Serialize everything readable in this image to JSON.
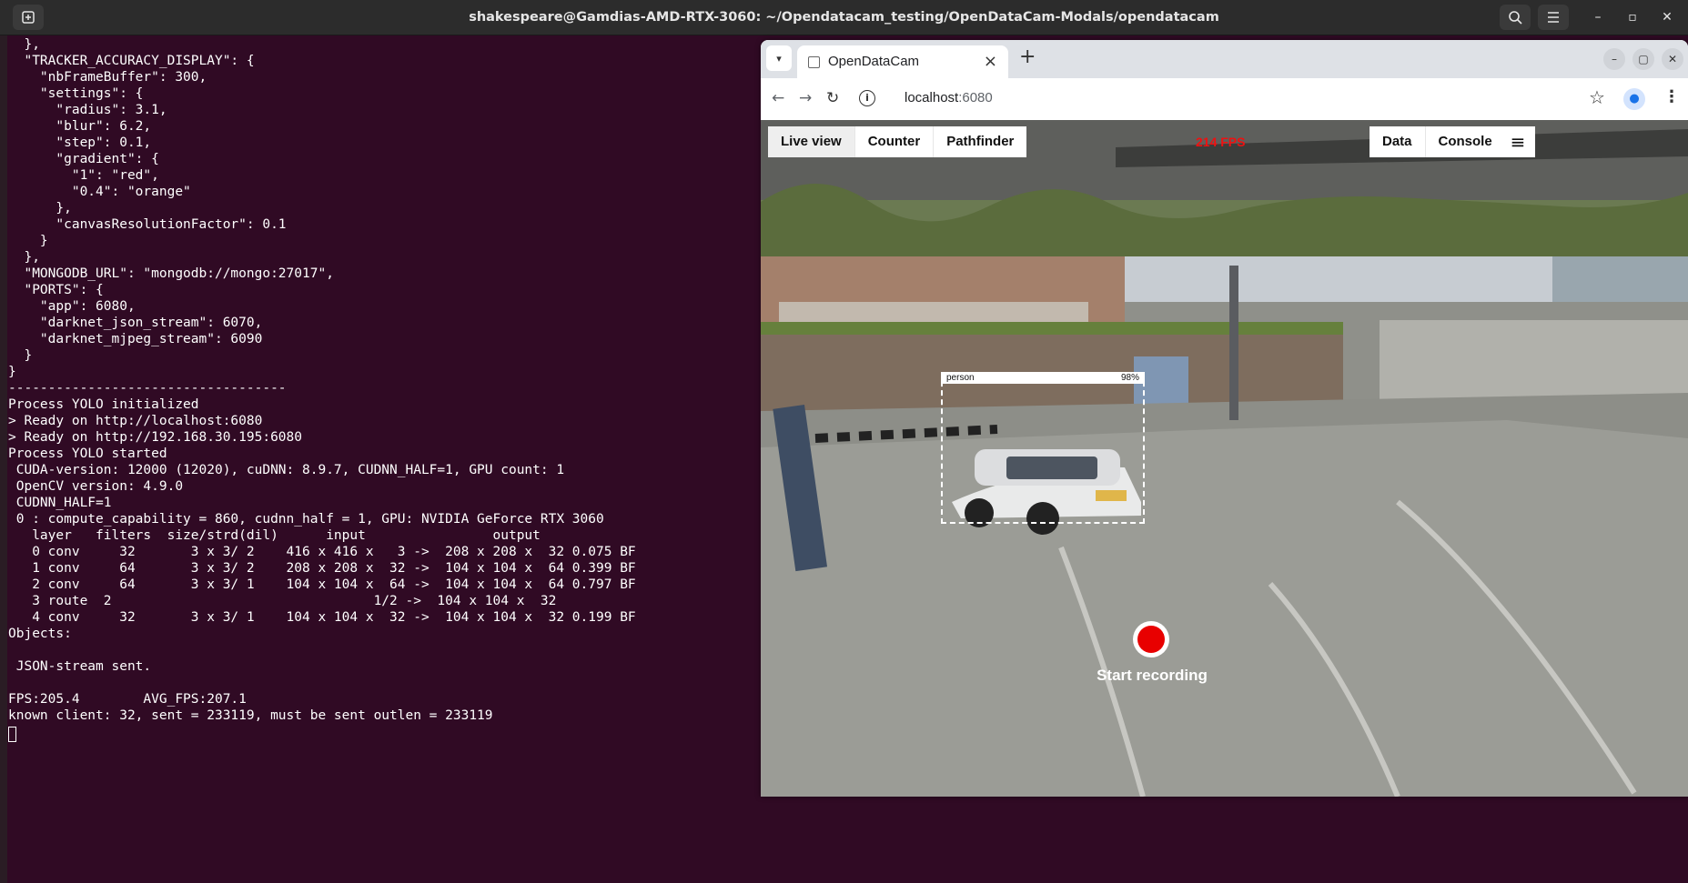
{
  "titlebar": {
    "title": "shakespeare@Gamdias-AMD-RTX-3060: ~/Opendatacam_testing/OpenDataCam-Modals/opendatacam"
  },
  "terminal": {
    "lines": [
      "  },",
      "  \"TRACKER_ACCURACY_DISPLAY\": {",
      "    \"nbFrameBuffer\": 300,",
      "    \"settings\": {",
      "      \"radius\": 3.1,",
      "      \"blur\": 6.2,",
      "      \"step\": 0.1,",
      "      \"gradient\": {",
      "        \"1\": \"red\",",
      "        \"0.4\": \"orange\"",
      "      },",
      "      \"canvasResolutionFactor\": 0.1",
      "    }",
      "  },",
      "  \"MONGODB_URL\": \"mongodb://mongo:27017\",",
      "  \"PORTS\": {",
      "    \"app\": 6080,",
      "    \"darknet_json_stream\": 6070,",
      "    \"darknet_mjpeg_stream\": 6090",
      "  }",
      "}",
      "-----------------------------------",
      "Process YOLO initialized",
      "> Ready on http://localhost:6080",
      "> Ready on http://192.168.30.195:6080",
      "Process YOLO started",
      " CUDA-version: 12000 (12020), cuDNN: 8.9.7, CUDNN_HALF=1, GPU count: 1",
      " OpenCV version: 4.9.0",
      " CUDNN_HALF=1",
      " 0 : compute_capability = 860, cudnn_half = 1, GPU: NVIDIA GeForce RTX 3060",
      "   layer   filters  size/strd(dil)      input                output",
      "   0 conv     32       3 x 3/ 2    416 x 416 x   3 ->  208 x 208 x  32 0.075 BF",
      "   1 conv     64       3 x 3/ 2    208 x 208 x  32 ->  104 x 104 x  64 0.399 BF",
      "   2 conv     64       3 x 3/ 1    104 x 104 x  64 ->  104 x 104 x  64 0.797 BF",
      "   3 route  2                                 1/2 ->  104 x 104 x  32",
      "   4 conv     32       3 x 3/ 1    104 x 104 x  32 ->  104 x 104 x  32 0.199 BF",
      "Objects:",
      "",
      " JSON-stream sent.",
      "",
      "FPS:205.4        AVG_FPS:207.1",
      "known client: 32, sent = 233119, must be sent outlen = 233119"
    ]
  },
  "browser": {
    "tab_title": "OpenDataCam",
    "url_host": "localhost",
    "url_port": ":6080",
    "app": {
      "nav_left": [
        "Live view",
        "Counter",
        "Pathfinder"
      ],
      "nav_right": [
        "Data",
        "Console"
      ],
      "fps": "214 FPS",
      "detection": {
        "class": "person",
        "confidence": "98%"
      },
      "record_label": "Start recording"
    }
  },
  "icons": {
    "newtab": "new-tab-icon",
    "search": "search-icon",
    "menu": "hamburger-icon",
    "minimize": "minimize-icon",
    "maximize": "maximize-icon",
    "close": "close-icon"
  },
  "colors": {
    "terminal_bg": "#300a24",
    "fps_red": "#e11111",
    "record_red": "#e80000"
  }
}
